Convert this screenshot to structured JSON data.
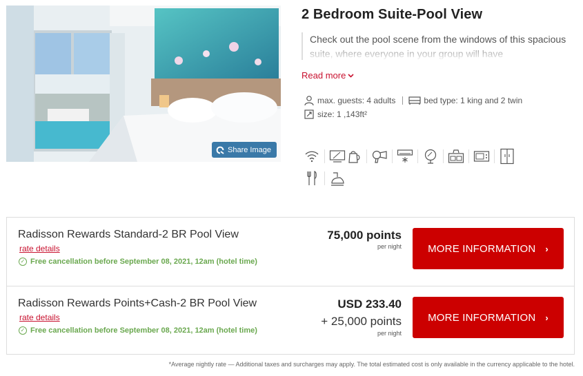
{
  "room": {
    "title": "2 Bedroom Suite-Pool View",
    "description": "Check out the pool scene from the windows of this spacious suite, where everyone in your group will have",
    "read_more": "Read more",
    "share_label": "Share Image",
    "specs": {
      "guests": "max. guests: 4 adults",
      "bed": "bed type: 1 king and 2 twin",
      "size": "size: 1 ,143ft²"
    },
    "amenities_row1": [
      "wifi-icon",
      "tv-icon",
      "kettle-icon",
      "hairdryer-icon",
      "air-conditioning-icon",
      "mirror-icon",
      "cooktop-icon",
      "microwave-icon",
      "refrigerator-icon"
    ],
    "amenities_row2": [
      "cutlery-icon",
      "iron-icon"
    ]
  },
  "rates": [
    {
      "name": "Radisson Rewards Standard-2 BR Pool View",
      "details": "rate details",
      "cancellation": "Free cancellation before September 08, 2021, 12am (hotel time)",
      "price_main": "75,000 points",
      "price_sub": "",
      "per_night": "per night",
      "button": "MORE INFORMATION"
    },
    {
      "name": "Radisson Rewards Points+Cash-2 BR Pool View",
      "details": "rate details",
      "cancellation": "Free cancellation before September 08, 2021, 12am (hotel time)",
      "price_main": "USD 233.40",
      "price_sub": "+ 25,000 points",
      "per_night": "per night",
      "button": "MORE INFORMATION"
    }
  ],
  "footnote": "*Average nightly rate — Additional taxes and surcharges may apply. The total estimated cost is only available in the currency applicable to the hotel.",
  "colors": {
    "accent": "#c8102e",
    "button": "#cc0000",
    "success": "#6aa84f",
    "share": "#3a79a8"
  }
}
